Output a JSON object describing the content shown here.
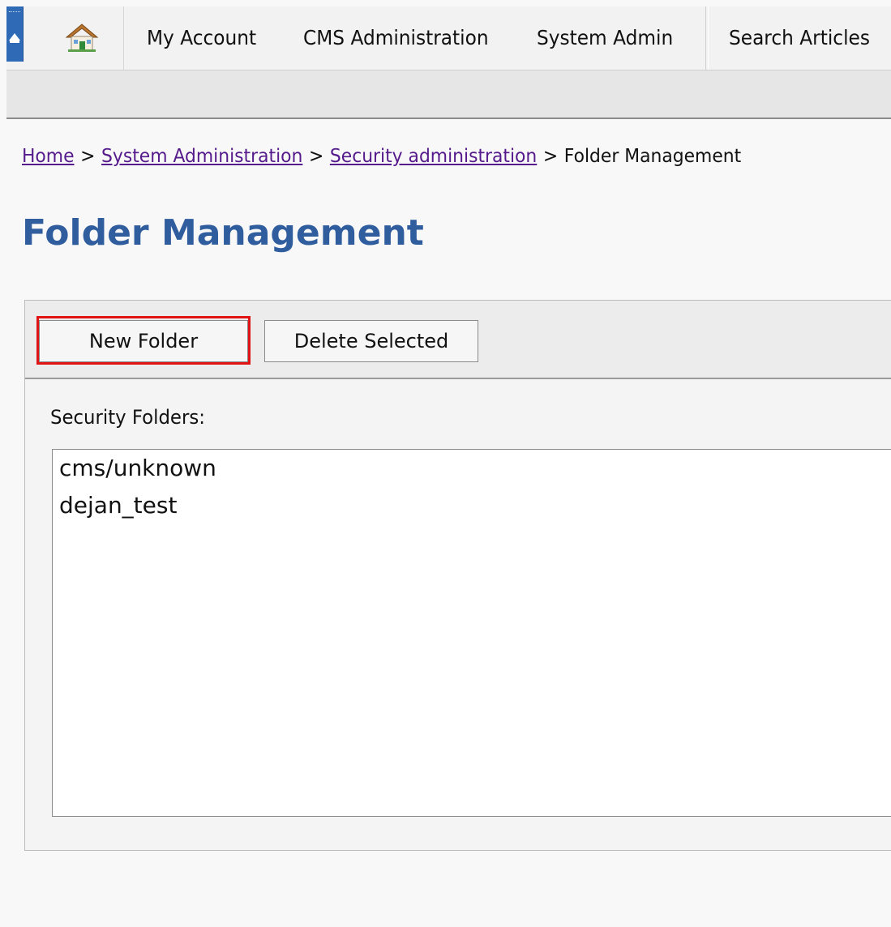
{
  "nav": {
    "items": [
      {
        "label": "My Account"
      },
      {
        "label": "CMS Administration"
      },
      {
        "label": "System Admin"
      },
      {
        "label": "Search Articles"
      }
    ]
  },
  "breadcrumb": {
    "home": "Home",
    "system_administration": "System Administration",
    "security_administration": "Security administration",
    "current": "Folder Management",
    "separator": ">"
  },
  "page": {
    "title": "Folder Management"
  },
  "toolbar": {
    "new_folder_label": "New Folder",
    "delete_selected_label": "Delete Selected"
  },
  "folders": {
    "label": "Security Folders:",
    "items": [
      "cms/unknown",
      "dejan_test"
    ]
  },
  "colors": {
    "accent": "#2f5d9e",
    "link": "#551a8b",
    "highlight": "#e01414",
    "collapse_tab": "#2f6ab7"
  },
  "icons": {
    "home": "home-icon",
    "collapse": "collapse-arrow-icon"
  }
}
